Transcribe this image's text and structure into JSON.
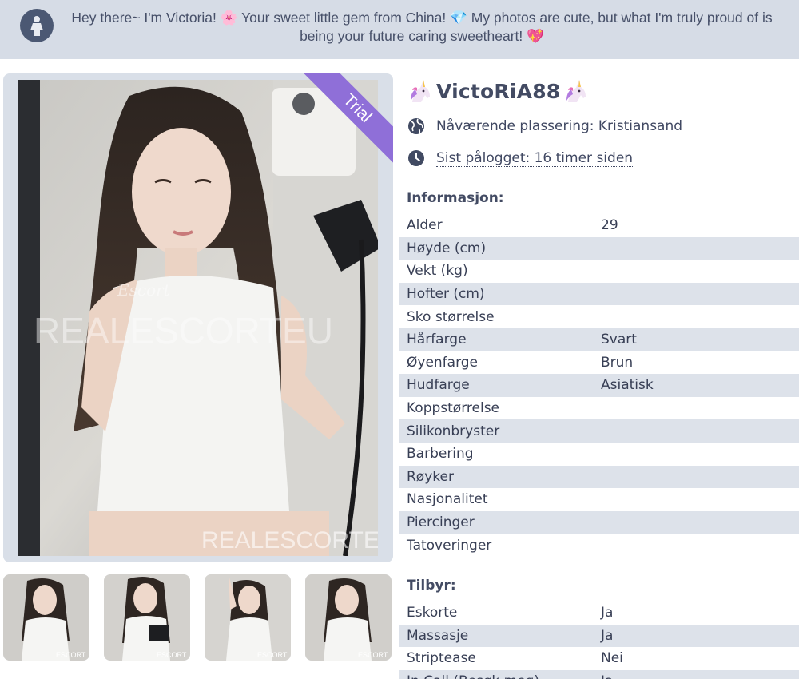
{
  "banner": {
    "text": "Hey there~ I'm Victoria! 🌸 Your sweet little gem from China! 💎 My photos are cute, but what I'm truly proud of is being your future caring sweetheart! 💖",
    "avatar_icon": "woman-icon"
  },
  "photo": {
    "ribbon": "Trial",
    "ribbon_color": "#8f6fd8",
    "watermark_main": "REALESCORTEU",
    "watermark_small": "Escort"
  },
  "thumbnails": [
    {
      "watermark": "ESCORT"
    },
    {
      "watermark": "ESCORT"
    },
    {
      "watermark": "ESCORT"
    },
    {
      "watermark": "ESCORT"
    }
  ],
  "profile": {
    "name": "VictoRiA88",
    "name_icons": "unicorn-icon",
    "location_label": "Nåværende plassering: Kristiansand",
    "last_login_label": "Sist pålogget: 16 timer siden"
  },
  "info": {
    "title": "Informasjon:",
    "rows": [
      {
        "key": "Alder",
        "value": "29"
      },
      {
        "key": "Høyde (cm)",
        "value": ""
      },
      {
        "key": "Vekt (kg)",
        "value": ""
      },
      {
        "key": "Hofter (cm)",
        "value": ""
      },
      {
        "key": "Sko størrelse",
        "value": ""
      },
      {
        "key": "Hårfarge",
        "value": "Svart"
      },
      {
        "key": "Øyenfarge",
        "value": "Brun"
      },
      {
        "key": "Hudfarge",
        "value": "Asiatisk"
      },
      {
        "key": "Koppstørrelse",
        "value": ""
      },
      {
        "key": "Silikonbryster",
        "value": ""
      },
      {
        "key": "Barbering",
        "value": ""
      },
      {
        "key": "Røyker",
        "value": ""
      },
      {
        "key": "Nasjonalitet",
        "value": ""
      },
      {
        "key": "Piercinger",
        "value": ""
      },
      {
        "key": "Tatoveringer",
        "value": ""
      }
    ]
  },
  "offers": {
    "title": "Tilbyr:",
    "rows": [
      {
        "key": "Eskorte",
        "value": "Ja"
      },
      {
        "key": "Massasje",
        "value": "Ja"
      },
      {
        "key": "Striptease",
        "value": "Nei"
      },
      {
        "key": "In Call (Besøk meg)",
        "value": "Ja"
      }
    ]
  },
  "colors": {
    "banner_bg": "#d6dce6",
    "row_stripe": "#dde2ea",
    "text": "#3b4257"
  }
}
